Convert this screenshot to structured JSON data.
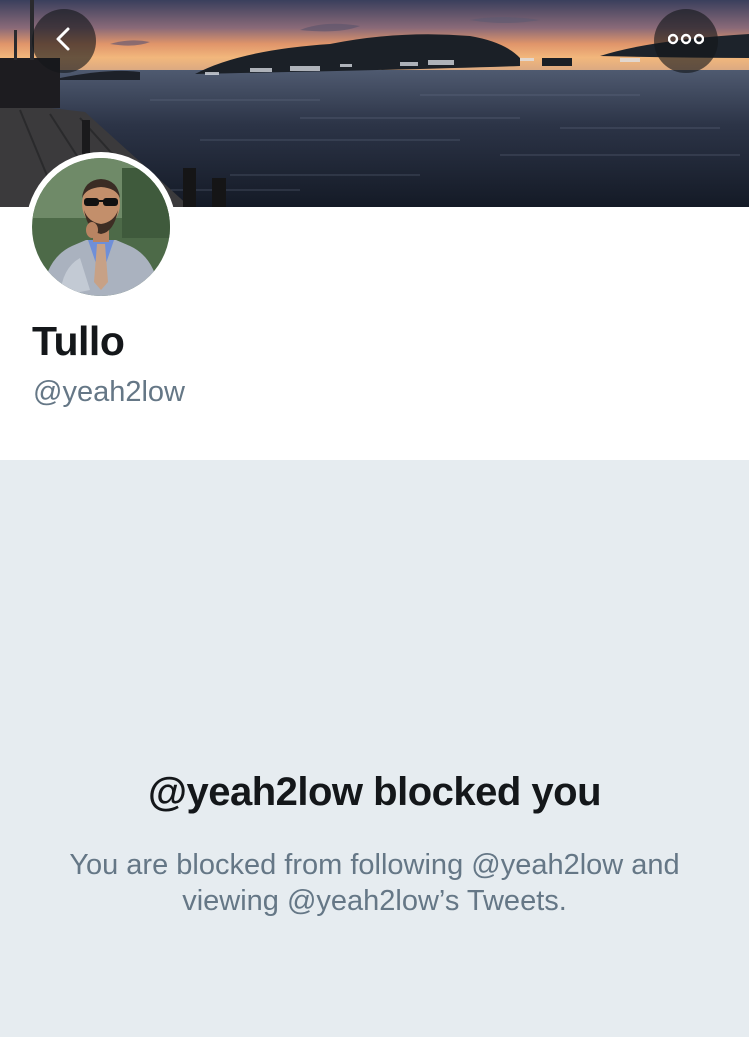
{
  "profile": {
    "display_name": "Tullo",
    "handle": "@yeah2low"
  },
  "blocked": {
    "title": "@yeah2low blocked you",
    "description": "You are blocked from following @yeah2low and viewing @yeah2low’s Tweets."
  },
  "icons": {
    "back": "chevron-left-icon",
    "more": "more-horizontal-icon"
  },
  "colors": {
    "text_primary": "#14171a",
    "text_secondary": "#657786",
    "blocked_background": "#e6ecf0"
  }
}
